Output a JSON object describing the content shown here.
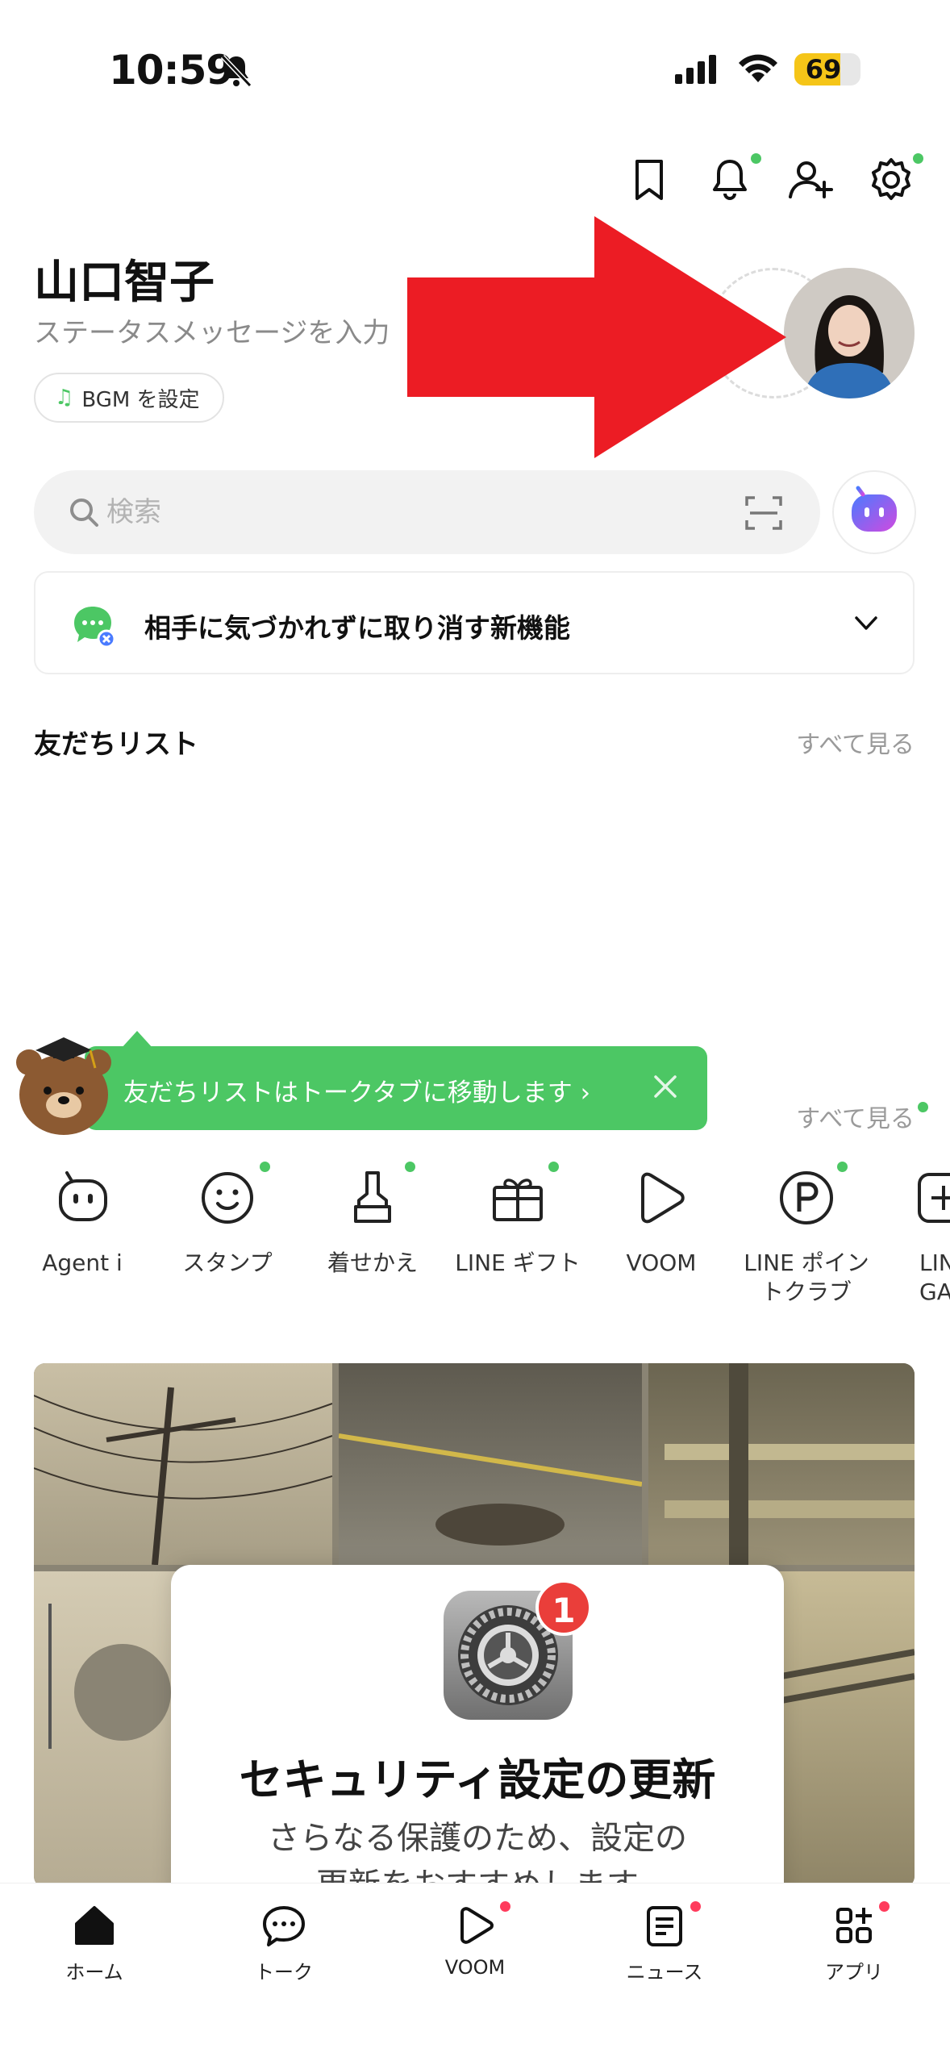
{
  "status_bar": {
    "time": "10:59",
    "battery": "69",
    "battery_level": 0.69
  },
  "profile": {
    "name": "山口智子",
    "status_message": "ステータスメッセージを入力",
    "bgm_label": "BGM を設定"
  },
  "search": {
    "placeholder": "検索"
  },
  "notice": {
    "text": "相手に気づかれずに取り消す新機能"
  },
  "friends": {
    "title": "友だちリスト",
    "see_all": "すべて見る",
    "tooltip": "友だちリストはトークタブに移動します ›",
    "see_all_2": "すべて見る"
  },
  "services": [
    {
      "label": "Agent i",
      "icon": "agent-face-icon"
    },
    {
      "label": "スタンプ",
      "icon": "smile-icon"
    },
    {
      "label": "着せかえ",
      "icon": "brush-icon"
    },
    {
      "label": "LINE ギフト",
      "icon": "gift-icon"
    },
    {
      "label": "VOOM",
      "icon": "play-icon"
    },
    {
      "label": "LINE ポイン\nトクラブ",
      "icon": "point-icon"
    },
    {
      "label": "LIN\nGA",
      "icon": "game-icon"
    }
  ],
  "banner": {
    "badge": "1",
    "title": "セキュリティ設定の更新",
    "subtitle": "さらなる保護のため、設定の\n更新をおすすめします"
  },
  "tabs": [
    {
      "label": "ホーム",
      "icon": "home-icon"
    },
    {
      "label": "トーク",
      "icon": "chat-icon"
    },
    {
      "label": "VOOM",
      "icon": "voom-icon"
    },
    {
      "label": "ニュース",
      "icon": "news-icon"
    },
    {
      "label": "アプリ",
      "icon": "apps-icon"
    }
  ],
  "colors": {
    "line_green": "#4cc764",
    "arrow_red": "#ec1c24",
    "badge_red": "#ea3e3a"
  }
}
